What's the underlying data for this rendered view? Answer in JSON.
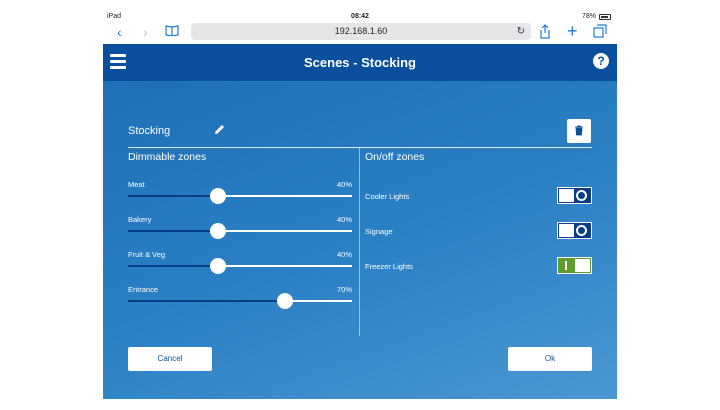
{
  "status_bar": {
    "device": "iPad",
    "time": "08:42",
    "battery": "78%"
  },
  "browser": {
    "url": "192.168.1.60",
    "back_icon": "chevron-left-icon",
    "forward_icon": "chevron-right-icon",
    "bookmarks_icon": "book-icon",
    "reload_icon": "reload-icon",
    "share_icon": "share-icon",
    "new_tab_icon": "plus-icon",
    "tabs_icon": "tabs-icon"
  },
  "header": {
    "title": "Scenes - Stocking",
    "help": "?"
  },
  "scene": {
    "name": "Stocking"
  },
  "dimmable": {
    "title": "Dimmable zones",
    "zones": [
      {
        "label": "Meat",
        "value": "40%",
        "level": 0.4
      },
      {
        "label": "Bakery",
        "value": "40%",
        "level": 0.4
      },
      {
        "label": "Fruit & Veg",
        "value": "40%",
        "level": 0.4
      },
      {
        "label": "Entrance",
        "value": "70%",
        "level": 0.7
      }
    ]
  },
  "onoff": {
    "title": "On/off zones",
    "zones": [
      {
        "label": "Cooler Lights",
        "on": false
      },
      {
        "label": "Signage",
        "on": false
      },
      {
        "label": "Freezer Lights",
        "on": true
      }
    ]
  },
  "actions": {
    "cancel": "Cancel",
    "ok": "Ok"
  },
  "colors": {
    "header": "#0a4f9e",
    "background": "#2b80c4",
    "slider_fill": "#0a3d86",
    "toggle_on": "#5f9c2b"
  }
}
